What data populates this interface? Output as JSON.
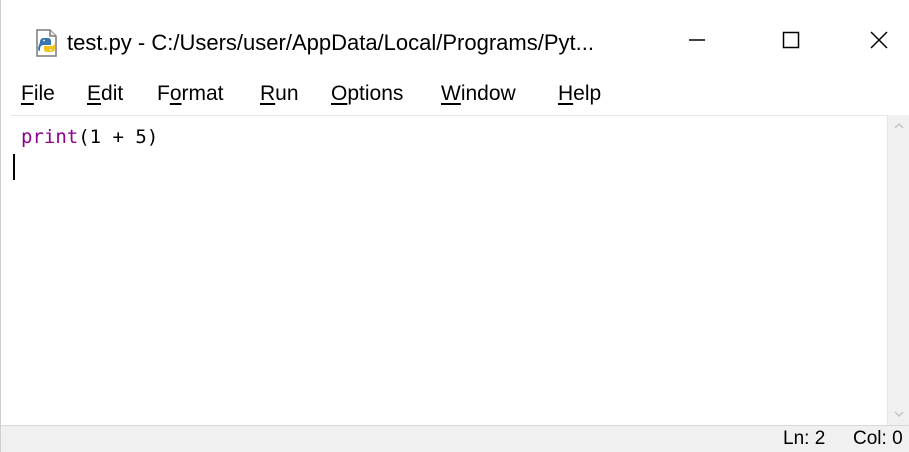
{
  "window": {
    "title": "test.py - C:/Users/user/AppData/Local/Programs/Pyt...",
    "icon": "python-file-icon",
    "controls": {
      "minimize_icon": "minimize-icon",
      "maximize_icon": "maximize-icon",
      "close_icon": "close-icon"
    }
  },
  "menubar": {
    "items": [
      {
        "first": "F",
        "rest": "ile",
        "full": "File"
      },
      {
        "first": "E",
        "rest": "dit",
        "full": "Edit"
      },
      {
        "pre": "F",
        "ul": "o",
        "post": "rmat",
        "full": "Format"
      },
      {
        "first": "R",
        "rest": "un",
        "full": "Run"
      },
      {
        "first": "O",
        "rest": "ptions",
        "full": "Options"
      },
      {
        "first": "W",
        "rest": "indow",
        "full": "Window"
      },
      {
        "first": "H",
        "rest": "elp",
        "full": "Help"
      }
    ]
  },
  "editor": {
    "lines": [
      {
        "builtin": "print",
        "rest": "(1 + 5)"
      }
    ],
    "colors": {
      "builtin": "#900090",
      "text": "#000000"
    }
  },
  "statusbar": {
    "line": "Ln: 2",
    "col": "Col: 0"
  }
}
